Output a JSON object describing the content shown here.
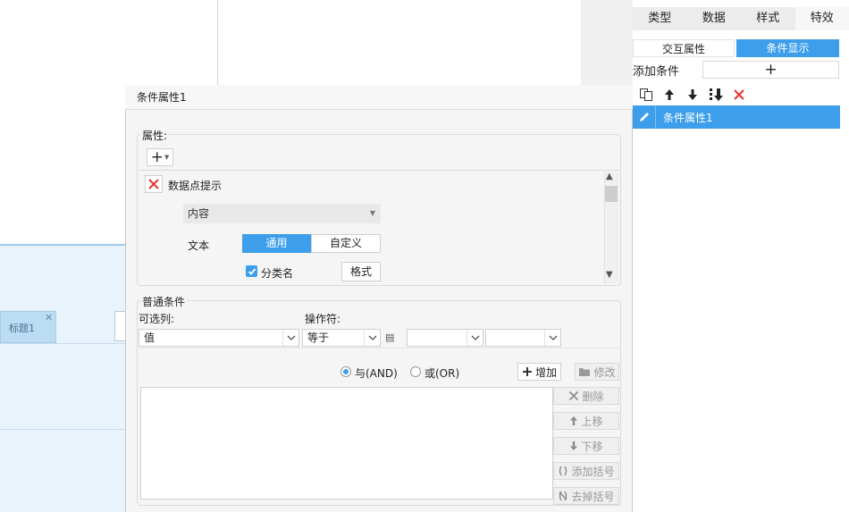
{
  "canvas": {
    "tab_label": "标题1",
    "tab_close": "✕"
  },
  "right_panel": {
    "tabs": [
      "类型",
      "数据",
      "样式",
      "特效"
    ],
    "sub_tabs": {
      "interactive": "交互属性",
      "conditional": "条件显示"
    },
    "add_condition_label": "添加条件",
    "add_button": "+",
    "items": [
      {
        "label": "条件属性1"
      }
    ]
  },
  "dialog": {
    "title": "条件属性1",
    "attributes": {
      "legend": "属性:",
      "add_glyph": "+",
      "dropdown_caret": "▼",
      "data_point_label": "数据点提示",
      "content_select": "内容",
      "text_label": "文本",
      "segment_general": "通用",
      "segment_custom": "自定义",
      "category_checkbox_label": "分类名",
      "category_checked": true,
      "format_button": "格式",
      "scroll_up": "▲",
      "scroll_down": "▼"
    },
    "condition": {
      "legend": "普通条件",
      "column_label": "可选列:",
      "operator_label": "操作符:",
      "column_value": "值",
      "operator_value": "等于",
      "value_icon_glyph": "▤",
      "value1": "",
      "value2": "",
      "radio_and": "与(AND)",
      "radio_or": "或(OR)",
      "and_selected": true,
      "add_button": "增加",
      "modify_button": "修改",
      "delete_button": "删除",
      "up_button": "上移",
      "down_button": "下移",
      "add_paren_button": "添加括号",
      "remove_paren_button": "去掉括号"
    }
  },
  "colors": {
    "accent": "#3d9fec",
    "delete_red": "#e53935"
  }
}
